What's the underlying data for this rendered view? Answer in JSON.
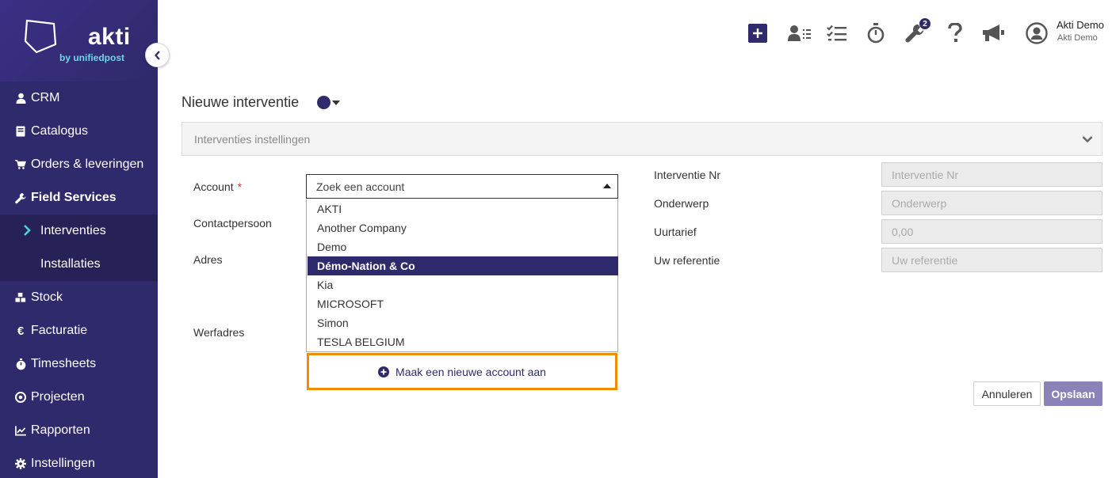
{
  "brand": {
    "name": "akti",
    "tagline": "by unifiedpost"
  },
  "sidebar": {
    "items": [
      {
        "label": "CRM",
        "icon": "user-icon"
      },
      {
        "label": "Catalogus",
        "icon": "book-icon"
      },
      {
        "label": "Orders & leveringen",
        "icon": "cart-icon"
      },
      {
        "label": "Field Services",
        "icon": "wrench-icon",
        "active": true
      },
      {
        "label": "Stock",
        "icon": "cubes-icon"
      },
      {
        "label": "Facturatie",
        "icon": "euro-icon"
      },
      {
        "label": "Timesheets",
        "icon": "stopwatch-icon"
      },
      {
        "label": "Projecten",
        "icon": "target-icon"
      },
      {
        "label": "Rapporten",
        "icon": "chart-line-icon"
      },
      {
        "label": "Instellingen",
        "icon": "gear-icon"
      }
    ],
    "subitems": [
      {
        "label": "Interventies",
        "active": true
      },
      {
        "label": "Installaties"
      }
    ]
  },
  "topbar": {
    "icons": [
      "plus-icon",
      "contacts-list-icon",
      "tasks-icon",
      "stopwatch-icon",
      "wrench-icon",
      "question-icon",
      "megaphone-icon",
      "user-circle-icon"
    ],
    "notification_count": "2",
    "user_name": "Akti Demo",
    "user_company": "Akti Demo"
  },
  "page": {
    "title": "Nieuwe interventie",
    "status_color": "#2f2a6b",
    "settings_panel": "Interventies instellingen"
  },
  "form": {
    "account_label": "Account",
    "required_mark": "*",
    "contact_label": "Contactpersoon",
    "address_label": "Adres",
    "site_address_label": "Werfadres",
    "account_placeholder": "Zoek een account",
    "accounts": [
      "AKTI",
      "Another Company",
      "Demo",
      "Démo-Nation & Co",
      "Kia",
      "MICROSOFT",
      "Simon",
      "TESLA BELGIUM"
    ],
    "highlighted_account": "Démo-Nation & Co",
    "new_account_label": "Maak een nieuwe account aan",
    "right_fields": [
      {
        "label": "Interventie Nr",
        "placeholder": "Interventie Nr"
      },
      {
        "label": "Onderwerp",
        "placeholder": "Onderwerp"
      },
      {
        "label": "Uurtarief",
        "placeholder": "0,00"
      },
      {
        "label": "Uw referentie",
        "placeholder": "Uw referentie"
      }
    ],
    "cancel_label": "Annuleren",
    "save_label": "Opslaan"
  },
  "colors": {
    "sidebar": "#2f2a6b",
    "accent": "#2f2a6b",
    "highlight_border": "#f08c00",
    "save_button": "#8a82b8"
  }
}
